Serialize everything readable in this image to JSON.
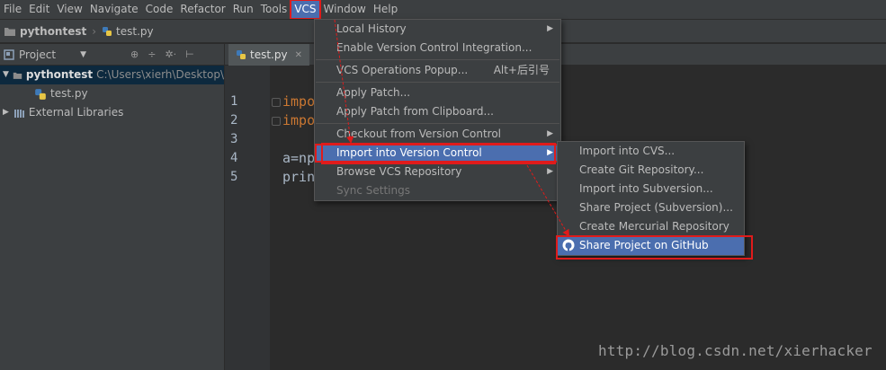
{
  "menubar": {
    "items": [
      "File",
      "Edit",
      "View",
      "Navigate",
      "Code",
      "Refactor",
      "Run",
      "Tools",
      "VCS",
      "Window",
      "Help"
    ],
    "active": "VCS"
  },
  "navbar": {
    "project": "pythontest",
    "file": "test.py"
  },
  "project_panel": {
    "title": "Project",
    "tree": {
      "root_name": "pythontest",
      "root_path": "C:\\Users\\xierh\\Desktop\\",
      "file": "test.py",
      "libraries": "External Libraries"
    }
  },
  "editor": {
    "tab": "test.py",
    "line_numbers": [
      "1",
      "2",
      "3",
      "4",
      "5"
    ],
    "lines": [
      "impo",
      "impo",
      "",
      "a=np",
      "prin"
    ]
  },
  "vcs_menu": {
    "items": [
      {
        "label": "Local History",
        "shortcut": "",
        "submenu": true,
        "disabled": false
      },
      {
        "label": "Enable Version Control Integration...",
        "shortcut": "",
        "submenu": false,
        "disabled": false
      },
      {
        "label": "VCS Operations Popup...",
        "shortcut": "Alt+后引号",
        "submenu": false,
        "disabled": false
      },
      {
        "label": "Apply Patch...",
        "shortcut": "",
        "submenu": false,
        "disabled": false
      },
      {
        "label": "Apply Patch from Clipboard...",
        "shortcut": "",
        "submenu": false,
        "disabled": false
      },
      {
        "label": "Checkout from Version Control",
        "shortcut": "",
        "submenu": true,
        "disabled": false
      },
      {
        "label": "Import into Version Control",
        "shortcut": "",
        "submenu": true,
        "disabled": false,
        "highlighted": true
      },
      {
        "label": "Browse VCS Repository",
        "shortcut": "",
        "submenu": true,
        "disabled": false
      },
      {
        "label": "Sync Settings",
        "shortcut": "",
        "submenu": false,
        "disabled": true
      }
    ]
  },
  "import_submenu": {
    "items": [
      {
        "label": "Import into CVS..."
      },
      {
        "label": "Create Git Repository..."
      },
      {
        "label": "Import into Subversion..."
      },
      {
        "label": "Share Project (Subversion)..."
      },
      {
        "label": "Create Mercurial Repository"
      },
      {
        "label": "Share Project on GitHub",
        "highlighted": true
      }
    ]
  },
  "watermark": "http://blog.csdn.net/xierhacker",
  "colors": {
    "highlight": "#4b6eaf",
    "annotation_red": "#e01b1b",
    "panel": "#3c3f41",
    "editor_bg": "#2b2b2b"
  }
}
